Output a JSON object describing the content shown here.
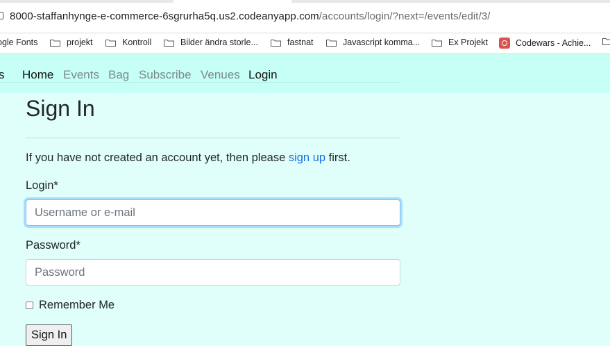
{
  "browser": {
    "url_host": "8000-staffanhynge-e-commerce-6sgrurha5q.us2.codeanyapp.com",
    "url_path": "/accounts/login/?next=/events/edit/3/"
  },
  "bookmarks": [
    {
      "label": "ogle Fonts",
      "icon": "none"
    },
    {
      "label": "projekt",
      "icon": "folder-icon"
    },
    {
      "label": "Kontroll",
      "icon": "folder-icon"
    },
    {
      "label": "Bilder ändra storle...",
      "icon": "folder-icon"
    },
    {
      "label": "fastnat",
      "icon": "folder-icon"
    },
    {
      "label": "Javascript komma...",
      "icon": "folder-icon"
    },
    {
      "label": "Ex Projekt",
      "icon": "folder-icon"
    },
    {
      "label": "Codewars - Achie...",
      "icon": "codewars-icon"
    },
    {
      "label": "",
      "icon": "folder-icon"
    }
  ],
  "nav": {
    "brand_tail": "s",
    "home": "Home",
    "events": "Events",
    "bag": "Bag",
    "subscribe": "Subscribe",
    "venues": "Venues",
    "login": "Login"
  },
  "main": {
    "title": "Sign In",
    "info_before": "If you have not created an account yet, then please ",
    "info_link": "sign up",
    "info_after": " first.",
    "login_label": "Login*",
    "login_placeholder": "Username or e-mail",
    "password_label": "Password*",
    "password_placeholder": "Password",
    "remember_label": "Remember Me",
    "submit_label": "Sign In"
  },
  "colors": {
    "page_bg": "#e0fffa",
    "nav_bg": "#c6fff5",
    "link": "#1a6fe0",
    "focus_ring": "#80bdff"
  }
}
